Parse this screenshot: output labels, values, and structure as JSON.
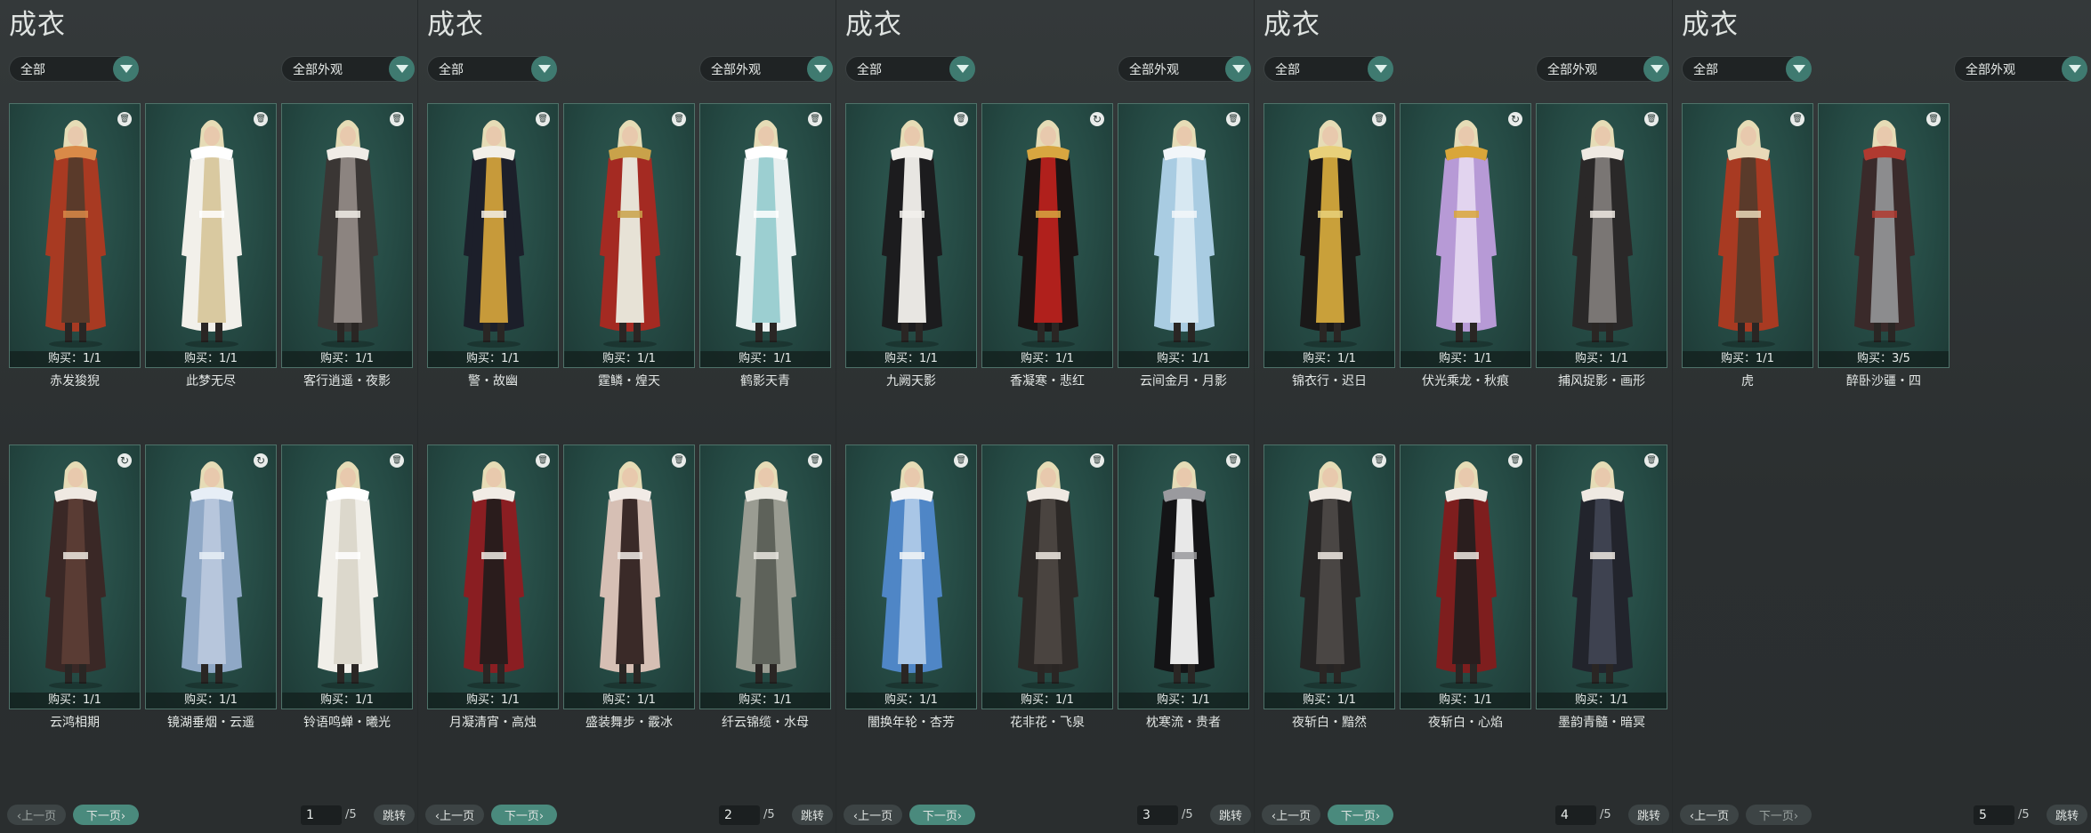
{
  "title": "成衣",
  "filter_category": "全部",
  "filter_appearance": "全部外观",
  "buy_prefix": "购买：",
  "prev_label": "上一页",
  "next_label": "下一页",
  "jump_label": "跳转",
  "total_pages": "/5",
  "colors": {
    "accent": "#3f7a70",
    "card_bg": "#2a524b",
    "card_border": "#4f7269"
  },
  "pages": [
    {
      "page": "1",
      "items": [
        {
          "name": "赤发狻猊",
          "buy": "1/1",
          "icon": "trash-icon",
          "palette": [
            "#a83a22",
            "#5a3a2a",
            "#d98a48"
          ]
        },
        {
          "name": "此梦无尽",
          "buy": "1/1",
          "icon": "trash-icon",
          "palette": [
            "#f2f0ea",
            "#d9c9a0",
            "#ffffff"
          ]
        },
        {
          "name": "客行逍遥・夜影",
          "buy": "1/1",
          "icon": "trash-icon",
          "palette": [
            "#3a3634",
            "#8c8480",
            "#f0ece6"
          ]
        },
        {
          "name": "云鸿相期",
          "buy": "1/1",
          "icon": "refresh-icon",
          "palette": [
            "#3a2826",
            "#5a3c34",
            "#efe9e2"
          ]
        },
        {
          "name": "镜湖垂烟・云遥",
          "buy": "1/1",
          "icon": "refresh-icon",
          "palette": [
            "#8fa8c6",
            "#b7c6dc",
            "#e7eef6"
          ]
        },
        {
          "name": "铃语鸣蝉・曦光",
          "buy": "1/1",
          "icon": "trash-icon",
          "palette": [
            "#f1efe9",
            "#dcd8cc",
            "#ffffff"
          ]
        }
      ]
    },
    {
      "page": "2",
      "items": [
        {
          "name": "警・故幽",
          "buy": "1/1",
          "icon": "trash-icon",
          "palette": [
            "#1c1f2a",
            "#c79a3a",
            "#f2efe8"
          ]
        },
        {
          "name": "霆鳞・煌天",
          "buy": "1/1",
          "icon": "trash-icon",
          "palette": [
            "#a42a22",
            "#e7e2d6",
            "#c9a24a"
          ]
        },
        {
          "name": "鹤影天青",
          "buy": "1/1",
          "icon": "trash-icon",
          "palette": [
            "#e9f0f0",
            "#9ccfd1",
            "#ffffff"
          ]
        },
        {
          "name": "月凝清宵・高烛",
          "buy": "1/1",
          "icon": "trash-icon",
          "palette": [
            "#8a1e22",
            "#2a1c1c",
            "#f1ece5"
          ]
        },
        {
          "name": "盛装舞步・霰冰",
          "buy": "1/1",
          "icon": "trash-icon",
          "palette": [
            "#d6bfb4",
            "#3a2a28",
            "#f1ebe6"
          ]
        },
        {
          "name": "纤云锦缆・水母",
          "buy": "1/1",
          "icon": "trash-icon",
          "palette": [
            "#9a9c92",
            "#5e625a",
            "#eae8e0"
          ]
        }
      ]
    },
    {
      "page": "3",
      "items": [
        {
          "name": "九阙天影",
          "buy": "1/1",
          "icon": "trash-icon",
          "palette": [
            "#1c1c1e",
            "#e8e6e2",
            "#f2f0ec"
          ]
        },
        {
          "name": "香凝寒・悲红",
          "buy": "1/1",
          "icon": "refresh-icon",
          "palette": [
            "#1a1414",
            "#b0201c",
            "#d8a640"
          ]
        },
        {
          "name": "云间金月・月影",
          "buy": "1/1",
          "icon": "trash-icon",
          "palette": [
            "#a9cce2",
            "#d7e8f2",
            "#f2f6f9"
          ]
        },
        {
          "name": "闇换年轮・杏芳",
          "buy": "1/1",
          "icon": "trash-icon",
          "palette": [
            "#4f86c6",
            "#a9c6e6",
            "#f2f4f6"
          ]
        },
        {
          "name": "花非花・飞泉",
          "buy": "1/1",
          "icon": "trash-icon",
          "palette": [
            "#2c2826",
            "#4a4440",
            "#efe9e2"
          ]
        },
        {
          "name": "枕寒流・贵者",
          "buy": "1/1",
          "icon": "trash-icon",
          "palette": [
            "#141416",
            "#e8e8e8",
            "#9a9a9e"
          ]
        }
      ]
    },
    {
      "page": "4",
      "items": [
        {
          "name": "锦衣行・迟日",
          "buy": "1/1",
          "icon": "trash-icon",
          "palette": [
            "#1a1818",
            "#c9a03a",
            "#e8d07a"
          ]
        },
        {
          "name": "伏光乘龙・秋痕",
          "buy": "1/1",
          "icon": "refresh-icon",
          "palette": [
            "#b79ad6",
            "#e2d4ef",
            "#d9a63a"
          ]
        },
        {
          "name": "捕风捉影・画形",
          "buy": "1/1",
          "icon": "trash-icon",
          "palette": [
            "#2a2828",
            "#7a7674",
            "#efe9e2"
          ]
        },
        {
          "name": "夜斩白・黯然",
          "buy": "1/1",
          "icon": "trash-icon",
          "palette": [
            "#262424",
            "#4a4644",
            "#efe9e2"
          ]
        },
        {
          "name": "夜斩白・心焰",
          "buy": "1/1",
          "icon": "trash-icon",
          "palette": [
            "#7e1e1e",
            "#2a1e1e",
            "#efe9e2"
          ]
        },
        {
          "name": "墨韵青髓・暗冥",
          "buy": "1/1",
          "icon": "trash-icon",
          "palette": [
            "#22242c",
            "#3e4250",
            "#efe9e2"
          ]
        }
      ]
    },
    {
      "page": "5",
      "items": [
        {
          "name": "虎",
          "buy": "1/1",
          "icon": "trash-icon",
          "palette": [
            "#a83a22",
            "#5a3a2a",
            "#e9d9b8"
          ]
        },
        {
          "name": "醉卧沙疆・四",
          "buy": "3/5",
          "icon": "trash-icon",
          "palette": [
            "#3a2a2a",
            "#8c8c8e",
            "#b03a30"
          ]
        }
      ]
    }
  ]
}
